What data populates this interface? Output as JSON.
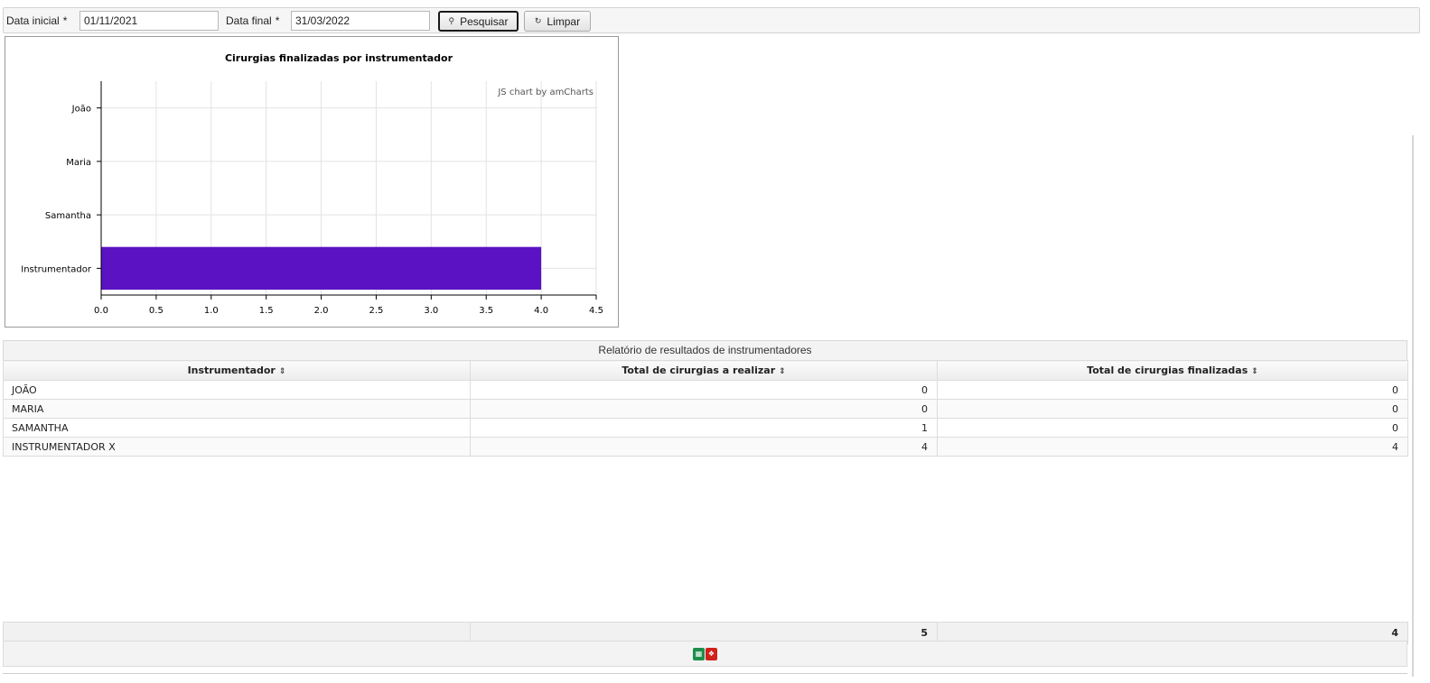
{
  "filters": {
    "start_label": "Data inicial",
    "start_value": "01/11/2021",
    "end_label": "Data final",
    "end_value": "31/03/2022",
    "required_mark": "*",
    "search_button": "Pesquisar",
    "clear_button": "Limpar"
  },
  "chart_data": {
    "type": "bar",
    "orientation": "horizontal",
    "title": "Cirurgias finalizadas por instrumentador",
    "credit": "JS chart by amCharts",
    "categories": [
      "João",
      "Maria",
      "Samantha",
      "Instrumentador"
    ],
    "values": [
      0,
      0,
      0,
      4
    ],
    "xlim": [
      0,
      4.5
    ],
    "ticks": [
      "0.0",
      "0.5",
      "1.0",
      "1.5",
      "2.0",
      "2.5",
      "3.0",
      "3.5",
      "4.0",
      "4.5"
    ],
    "grid": true,
    "bar_color": "#5b12c2"
  },
  "report": {
    "title": "Relatório de resultados de instrumentadores",
    "columns": [
      "Instrumentador",
      "Total de cirurgias a realizar",
      "Total de cirurgias finalizadas"
    ],
    "rows": [
      {
        "name": "JOÃO",
        "to_do": "0",
        "done": "0"
      },
      {
        "name": "MARIA",
        "to_do": "0",
        "done": "0"
      },
      {
        "name": "SAMANTHA",
        "to_do": "1",
        "done": "0"
      },
      {
        "name": "INSTRUMENTADOR X",
        "to_do": "4",
        "done": "4"
      }
    ],
    "totals": {
      "to_do": "5",
      "done": "4"
    }
  },
  "icons": {
    "search": "search-icon",
    "clear": "refresh-icon",
    "sort": "sort-icon",
    "excel": "excel-export-icon",
    "pdf": "pdf-export-icon"
  }
}
